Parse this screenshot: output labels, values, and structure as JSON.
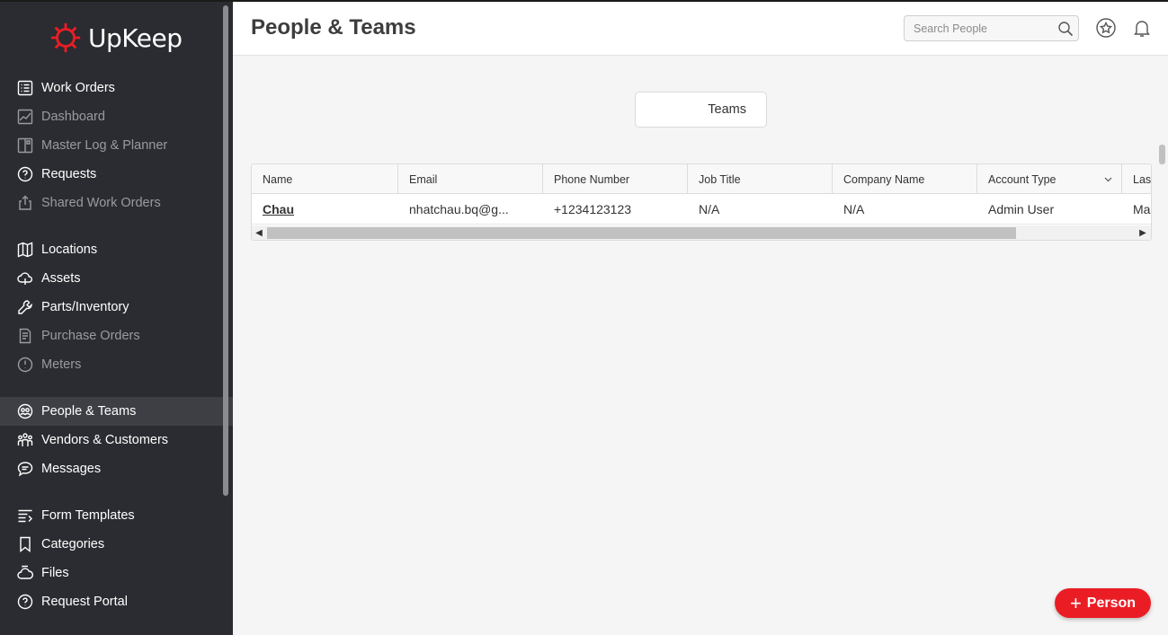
{
  "app": {
    "logo_text": "UpKeep",
    "brand_color": "#ea1d25"
  },
  "sidebar": {
    "items": [
      {
        "label": "Work Orders",
        "icon": "list-icon",
        "muted": false
      },
      {
        "label": "Dashboard",
        "icon": "chart-icon",
        "muted": true
      },
      {
        "label": "Master Log & Planner",
        "icon": "planner-icon",
        "muted": true
      },
      {
        "label": "Requests",
        "icon": "question-icon",
        "muted": false
      },
      {
        "label": "Shared Work Orders",
        "icon": "share-icon",
        "muted": true
      },
      {
        "label": "Locations",
        "icon": "map-icon",
        "muted": false
      },
      {
        "label": "Assets",
        "icon": "cloud-icon",
        "muted": false
      },
      {
        "label": "Parts/Inventory",
        "icon": "wrench-icon",
        "muted": false
      },
      {
        "label": "Purchase Orders",
        "icon": "document-icon",
        "muted": true
      },
      {
        "label": "Meters",
        "icon": "gauge-icon",
        "muted": true
      },
      {
        "label": "People & Teams",
        "icon": "people-icon",
        "muted": false,
        "active": true
      },
      {
        "label": "Vendors & Customers",
        "icon": "group-icon",
        "muted": false
      },
      {
        "label": "Messages",
        "icon": "chat-icon",
        "muted": false
      },
      {
        "label": "Form Templates",
        "icon": "form-icon",
        "muted": false
      },
      {
        "label": "Categories",
        "icon": "bookmark-icon",
        "muted": false
      },
      {
        "label": "Files",
        "icon": "files-icon",
        "muted": false
      },
      {
        "label": "Request Portal",
        "icon": "portal-icon",
        "muted": false
      }
    ]
  },
  "header": {
    "title": "People & Teams",
    "search_placeholder": "Search People"
  },
  "tabs": {
    "teams_label": "Teams"
  },
  "table": {
    "columns": [
      "Name",
      "Email",
      "Phone Number",
      "Job Title",
      "Company Name",
      "Account Type",
      "Last"
    ],
    "rows": [
      {
        "name": "Chau",
        "email": "nhatchau.bq@g...",
        "phone": "+1234123123",
        "job_title": "N/A",
        "company": "N/A",
        "account_type": "Admin User",
        "last": "Ma"
      }
    ]
  },
  "fab": {
    "label": "Person"
  }
}
